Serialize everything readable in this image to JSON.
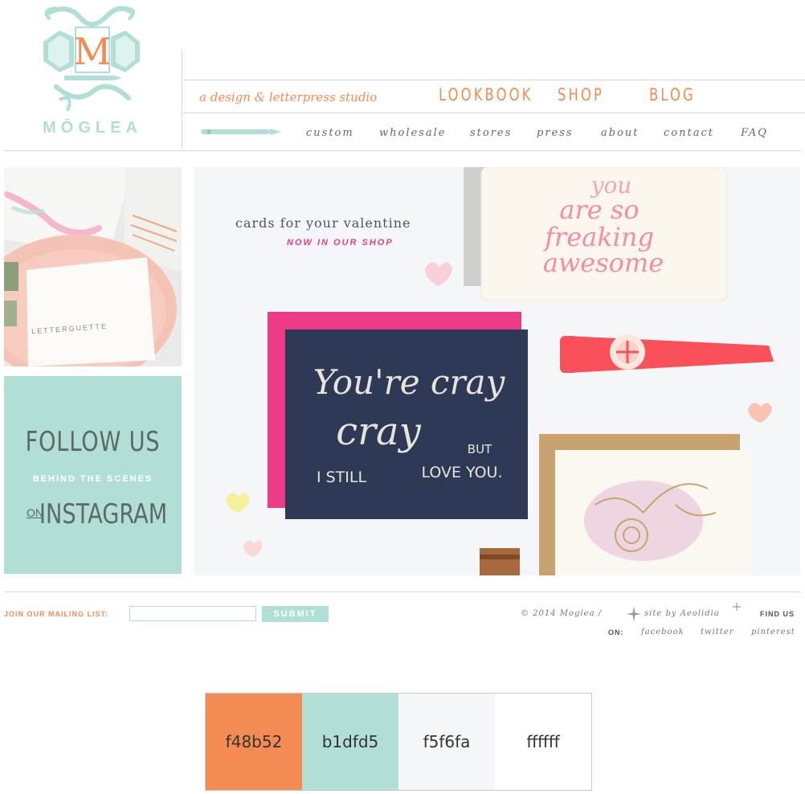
{
  "brand": {
    "logo_monogram": "M",
    "logo_word": "MŌGLEA",
    "tagline": "a design & letterpress studio"
  },
  "main_nav": [
    {
      "label": "LOOKBOOK"
    },
    {
      "label": "SHOP"
    },
    {
      "label": "BLOG"
    }
  ],
  "sub_nav": [
    {
      "label": "custom"
    },
    {
      "label": "wholesale"
    },
    {
      "label": "stores"
    },
    {
      "label": "press"
    },
    {
      "label": "about"
    },
    {
      "label": "contact"
    },
    {
      "label": "FAQ"
    }
  ],
  "left_photo": {
    "card_text": "LETTERGUETTE"
  },
  "instagram_promo": {
    "line1": "FOLLOW US",
    "line2": "BEHIND THE SCENES",
    "line3_prefix": "ON",
    "line3": "INSTAGRAM"
  },
  "hero": {
    "caption": "cards for your valentine",
    "cta": "NOW IN OUR SHOP",
    "card_main_line1": "You're cray",
    "card_main_line2": "cray",
    "card_main_line3": "I STILL",
    "card_main_line4": "BUT",
    "card_main_line5": "LOVE YOU.",
    "card_pink_line1": "you",
    "card_pink_line2": "are so",
    "card_pink_line3": "freaking",
    "card_pink_line4": "awesome"
  },
  "footer": {
    "mailing_label": "JOIN OUR MAILING LIST:",
    "mailing_value": "",
    "submit_label": "SUBMIT",
    "copyright": "© 2014  Moglea  /",
    "credit": "site by Aeolidia",
    "find_us": "FIND US",
    "on": "ON:",
    "social": [
      {
        "label": "facebook"
      },
      {
        "label": "twitter"
      },
      {
        "label": "pinterest"
      }
    ]
  },
  "palette": [
    {
      "hex": "f48b52",
      "color": "#f48b52"
    },
    {
      "hex": "b1dfd5",
      "color": "#b1dfd5"
    },
    {
      "hex": "f5f6fa",
      "color": "#f5f6fa"
    },
    {
      "hex": "ffffff",
      "color": "#ffffff"
    }
  ]
}
